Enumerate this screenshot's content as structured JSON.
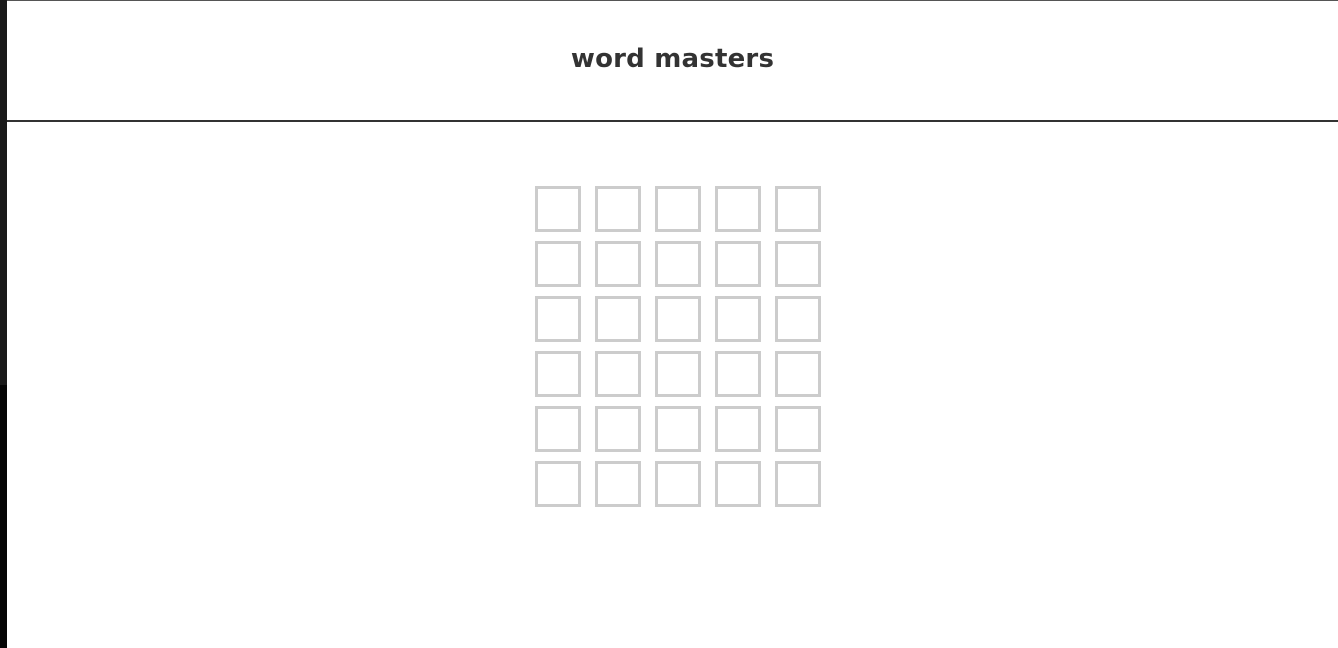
{
  "header": {
    "title": "word masters"
  },
  "board": {
    "rows": [
      [
        "",
        "",
        "",
        "",
        ""
      ],
      [
        "",
        "",
        "",
        "",
        ""
      ],
      [
        "",
        "",
        "",
        "",
        ""
      ],
      [
        "",
        "",
        "",
        "",
        ""
      ],
      [
        "",
        "",
        "",
        "",
        ""
      ],
      [
        "",
        "",
        "",
        "",
        ""
      ]
    ]
  },
  "colors": {
    "tile_border": "#cccccc",
    "text": "#333333",
    "navbar_border": "#333333",
    "background": "#ffffff"
  }
}
